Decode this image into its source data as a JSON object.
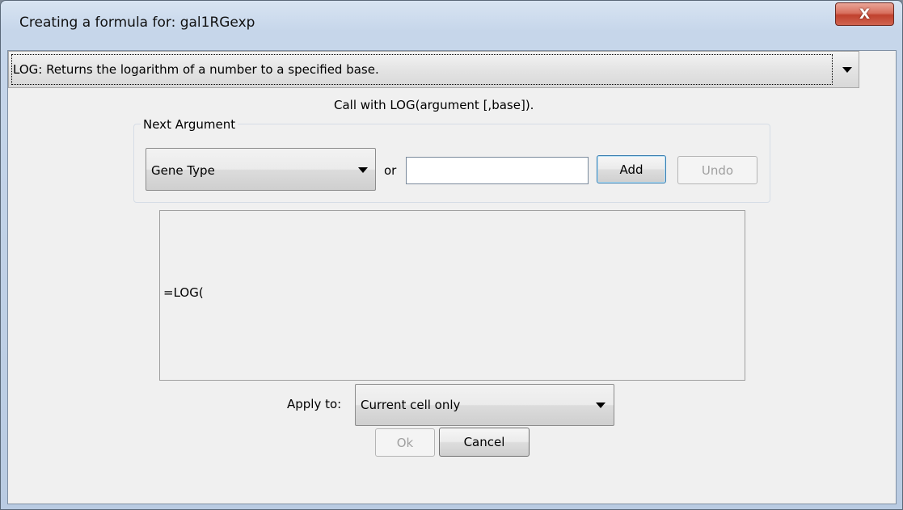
{
  "window": {
    "title": "Creating a formula for: gal1RGexp",
    "close_label": "X"
  },
  "function_select": {
    "selected": "LOG: Returns the logarithm of a number to a specified base."
  },
  "call_hint": "Call with LOG(argument [,base]).",
  "next_argument": {
    "legend": "Next Argument",
    "column_select": {
      "selected": "Gene Type"
    },
    "or_label": "or",
    "value_input": {
      "value": "",
      "placeholder": ""
    },
    "add_label": "Add",
    "undo_label": "Undo"
  },
  "formula": {
    "text": "=LOG("
  },
  "apply_to": {
    "label": "Apply to:",
    "selected": "Current cell only"
  },
  "footer": {
    "ok_label": "Ok",
    "cancel_label": "Cancel"
  },
  "icons": {
    "close": "close-icon",
    "dropdown": "chevron-down-icon"
  }
}
